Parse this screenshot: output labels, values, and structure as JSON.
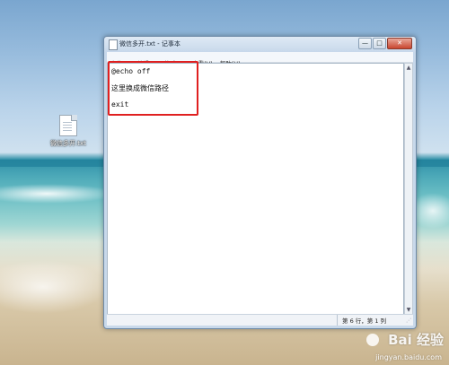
{
  "desktop": {
    "icon_label": "微信多开.txt"
  },
  "window": {
    "title": "微信多开.txt - 记事本",
    "buttons": {
      "minimize": "—",
      "maximize": "□",
      "close": "✕"
    }
  },
  "menu": [
    "文件(F)",
    "编辑(E)",
    "格式(O)",
    "查看(V)",
    "帮助(H)"
  ],
  "editor": {
    "lines": [
      "@echo off",
      "这里换成微信路径",
      "exit"
    ],
    "highlight_color": "#e02020"
  },
  "status": {
    "position": "第 6 行，第 1 列"
  },
  "scrollbar": {
    "up": "▲",
    "down": "▼"
  },
  "watermark": {
    "brand": "Bai 经验",
    "url": "jingyan.baidu.com"
  }
}
